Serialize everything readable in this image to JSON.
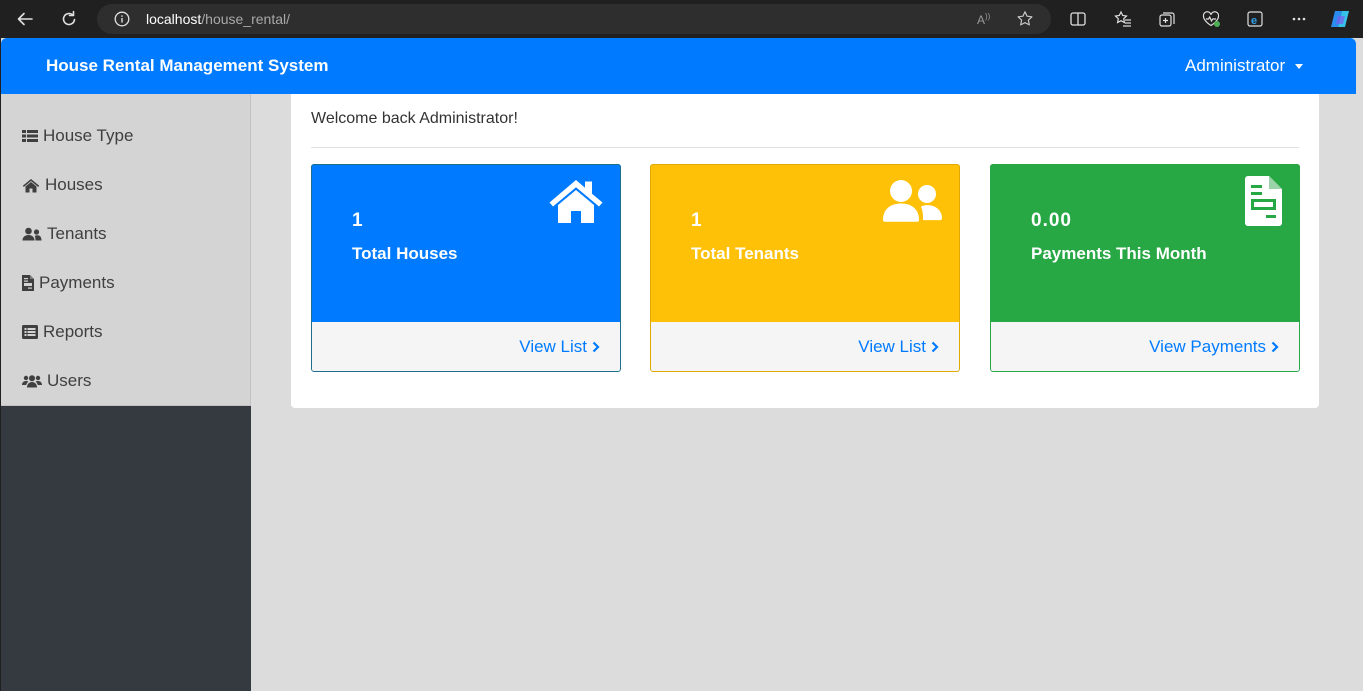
{
  "browser": {
    "url_host": "localhost",
    "url_path": "/house_rental/"
  },
  "header": {
    "brand": "House Rental Management System",
    "user": "Administrator"
  },
  "sidebar": {
    "items": [
      {
        "label": "House Type",
        "icon": "list-icon"
      },
      {
        "label": "Houses",
        "icon": "home-icon"
      },
      {
        "label": "Tenants",
        "icon": "user-friends-icon"
      },
      {
        "label": "Payments",
        "icon": "file-invoice-icon"
      },
      {
        "label": "Reports",
        "icon": "list-alt-icon"
      },
      {
        "label": "Users",
        "icon": "users-icon"
      }
    ]
  },
  "main": {
    "welcome": "Welcome back Administrator!",
    "stats": [
      {
        "value": "1",
        "label": "Total Houses",
        "link": "View List",
        "icon": "home-icon",
        "color": "#007bff"
      },
      {
        "value": "1",
        "label": "Total Tenants",
        "link": "View List",
        "icon": "user-friends-icon",
        "color": "#ffc107"
      },
      {
        "value": "0.00",
        "label": "Payments This Month",
        "link": "View Payments",
        "icon": "file-invoice-icon",
        "color": "#28a745"
      }
    ]
  },
  "colors": {
    "primary": "#007bff",
    "warning": "#ffc107",
    "success": "#28a745",
    "sidebar_dark": "#343a40",
    "sidebar_light": "#d4d4d4",
    "content_bg": "#dcdcdc"
  }
}
